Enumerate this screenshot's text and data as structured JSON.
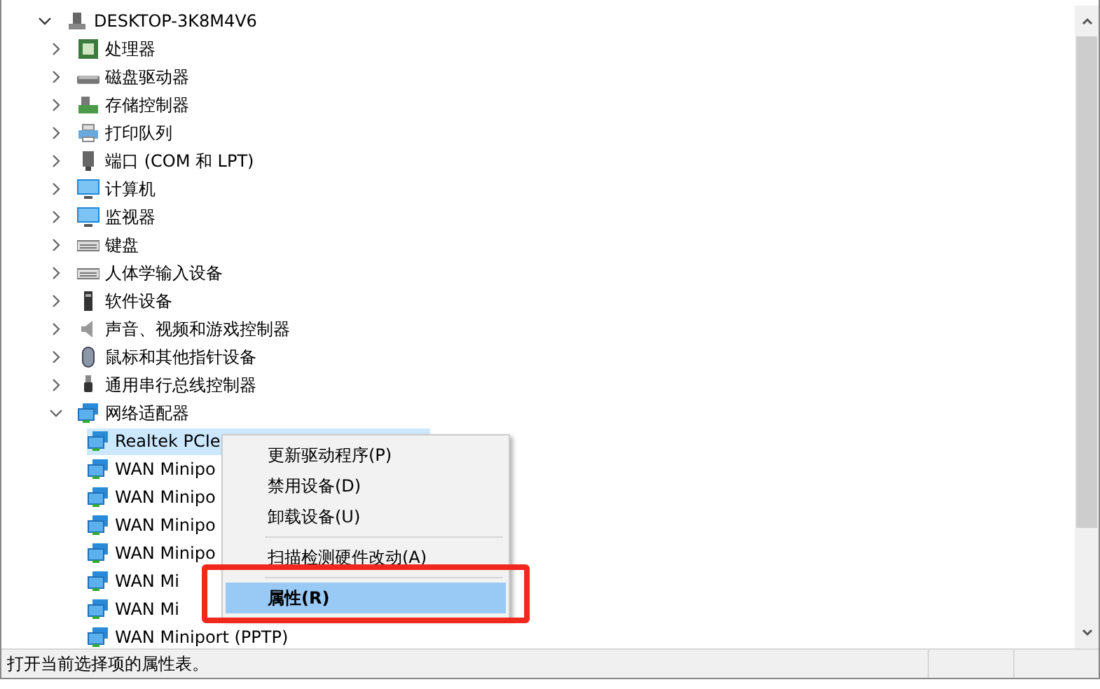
{
  "tree": {
    "label": "DESKTOP-3K8M4V6",
    "expanded": true,
    "children": [
      {
        "label": "处理器",
        "kind": "cpu",
        "expanded": false
      },
      {
        "label": "磁盘驱动器",
        "kind": "disk",
        "expanded": false
      },
      {
        "label": "存储控制器",
        "kind": "storage",
        "expanded": false
      },
      {
        "label": "打印队列",
        "kind": "printer",
        "expanded": false
      },
      {
        "label": "端口 (COM 和 LPT)",
        "kind": "port",
        "expanded": false
      },
      {
        "label": "计算机",
        "kind": "monitor",
        "expanded": false
      },
      {
        "label": "监视器",
        "kind": "monitor",
        "expanded": false
      },
      {
        "label": "键盘",
        "kind": "keyboard",
        "expanded": false
      },
      {
        "label": "人体学输入设备",
        "kind": "keyboard",
        "expanded": false
      },
      {
        "label": "软件设备",
        "kind": "tower",
        "expanded": false
      },
      {
        "label": "声音、视频和游戏控制器",
        "kind": "speaker",
        "expanded": false
      },
      {
        "label": "鼠标和其他指针设备",
        "kind": "mouse",
        "expanded": false
      },
      {
        "label": "通用串行总线控制器",
        "kind": "usb",
        "expanded": false
      },
      {
        "label": "网络适配器",
        "kind": "network",
        "expanded": true,
        "children": [
          {
            "label": "Realtek PCIe",
            "selected": true
          },
          {
            "label": "WAN Minipo",
            "selected": false
          },
          {
            "label": "WAN Minipo",
            "selected": false
          },
          {
            "label": "WAN Minipo",
            "selected": false
          },
          {
            "label": "WAN Minipo",
            "selected": false
          },
          {
            "label": "WAN Mi",
            "selected": false
          },
          {
            "label": "WAN Mi",
            "selected": false
          },
          {
            "label": "WAN Miniport (PPTP)",
            "selected": false
          }
        ]
      }
    ]
  },
  "context_menu": {
    "items": [
      {
        "label": "更新驱动程序(P)",
        "selected": false
      },
      {
        "label": "禁用设备(D)",
        "selected": false
      },
      {
        "label": "卸载设备(U)",
        "selected": false,
        "separator_after": true
      },
      {
        "label": "扫描检测硬件改动(A)",
        "selected": false,
        "separator_after": true
      },
      {
        "label": "属性(R)",
        "selected": true
      }
    ]
  },
  "status_bar": {
    "text": "打开当前选择项的属性表。"
  }
}
